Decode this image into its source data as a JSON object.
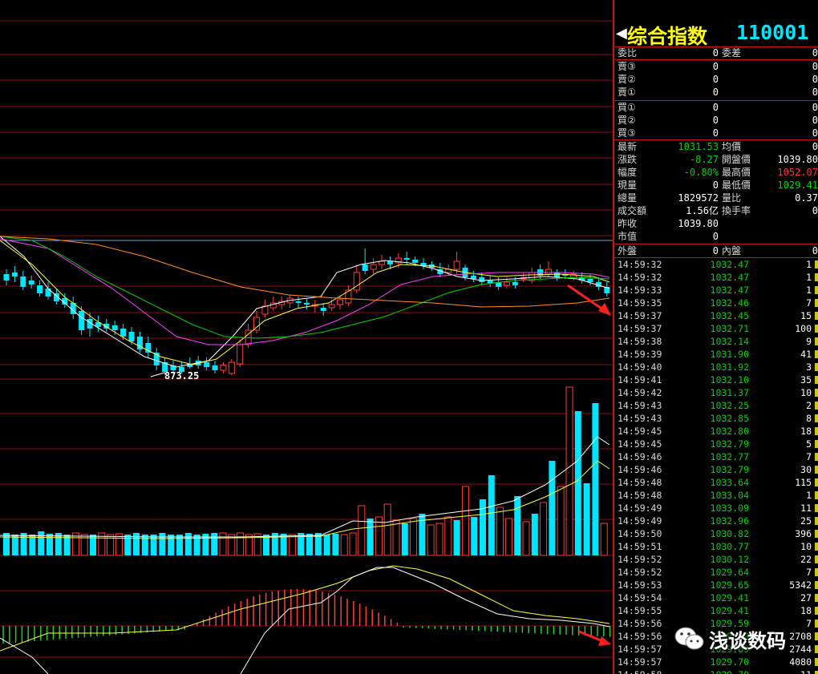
{
  "panel": {
    "title_name": "综合指数",
    "title_code": "110001",
    "order_ratio": {
      "label1": "委比",
      "value1": "0",
      "label2": "委差",
      "value2": "0"
    },
    "sell_levels": [
      {
        "label": "賣③",
        "value": "0"
      },
      {
        "label": "賣②",
        "value": "0"
      },
      {
        "label": "賣①",
        "value": "0"
      }
    ],
    "buy_levels": [
      {
        "label": "買①",
        "value": "0"
      },
      {
        "label": "買②",
        "value": "0"
      },
      {
        "label": "買③",
        "value": "0"
      }
    ],
    "stats": [
      {
        "l1": "最新",
        "v1": "1031.53",
        "c1": "#00d000",
        "l2": "均價",
        "v2": "0",
        "c2": "#ffffff"
      },
      {
        "l1": "漲跌",
        "v1": "-8.27",
        "c1": "#00d000",
        "l2": "開盤價",
        "v2": "1039.80",
        "c2": "#ffffff"
      },
      {
        "l1": "幅度",
        "v1": "-0.80%",
        "c1": "#00d000",
        "l2": "最高價",
        "v2": "1052.07",
        "c2": "#ff3030"
      },
      {
        "l1": "現量",
        "v1": "0",
        "c1": "#ffffff",
        "l2": "最低價",
        "v2": "1029.41",
        "c2": "#00d000"
      },
      {
        "l1": "總量",
        "v1": "1829572",
        "c1": "#ffffff",
        "l2": "量比",
        "v2": "0.37",
        "c2": "#ffffff"
      },
      {
        "l1": "成交額",
        "v1": "1.56亿",
        "c1": "#ffffff",
        "l2": "換手率",
        "v2": "0",
        "c2": "#ffffff"
      },
      {
        "l1": "昨收",
        "v1": "1039.80",
        "c1": "#ffffff",
        "l2": "",
        "v2": "",
        "c2": "#ffffff"
      },
      {
        "l1": "市值",
        "v1": "0",
        "c1": "#ffffff",
        "l2": "",
        "v2": "",
        "c2": "#ffffff"
      }
    ],
    "outer_inner": {
      "l1": "外盤",
      "v1": "0",
      "l2": "內盤",
      "v2": "0"
    },
    "trades": [
      {
        "time": "14:59:32",
        "price": "1032.47",
        "vol": "1"
      },
      {
        "time": "14:59:32",
        "price": "1032.47",
        "vol": "1"
      },
      {
        "time": "14:59:33",
        "price": "1032.47",
        "vol": "1"
      },
      {
        "time": "14:59:35",
        "price": "1032.46",
        "vol": "7"
      },
      {
        "time": "14:59:37",
        "price": "1032.45",
        "vol": "15"
      },
      {
        "time": "14:59:37",
        "price": "1032.71",
        "vol": "100"
      },
      {
        "time": "14:59:38",
        "price": "1032.14",
        "vol": "9"
      },
      {
        "time": "14:59:39",
        "price": "1031.90",
        "vol": "41"
      },
      {
        "time": "14:59:40",
        "price": "1031.92",
        "vol": "3"
      },
      {
        "time": "14:59:41",
        "price": "1032.10",
        "vol": "35"
      },
      {
        "time": "14:59:42",
        "price": "1031.37",
        "vol": "10"
      },
      {
        "time": "14:59:43",
        "price": "1032.25",
        "vol": "2"
      },
      {
        "time": "14:59:43",
        "price": "1032.85",
        "vol": "8"
      },
      {
        "time": "14:59:45",
        "price": "1032.80",
        "vol": "18"
      },
      {
        "time": "14:59:45",
        "price": "1032.79",
        "vol": "5"
      },
      {
        "time": "14:59:46",
        "price": "1032.77",
        "vol": "7"
      },
      {
        "time": "14:59:46",
        "price": "1032.79",
        "vol": "30"
      },
      {
        "time": "14:59:48",
        "price": "1033.64",
        "vol": "115"
      },
      {
        "time": "14:59:48",
        "price": "1033.04",
        "vol": "1"
      },
      {
        "time": "14:59:49",
        "price": "1033.09",
        "vol": "11"
      },
      {
        "time": "14:59:49",
        "price": "1032.96",
        "vol": "25"
      },
      {
        "time": "14:59:50",
        "price": "1030.82",
        "vol": "396"
      },
      {
        "time": "14:59:51",
        "price": "1030.77",
        "vol": "10"
      },
      {
        "time": "14:59:52",
        "price": "1030.12",
        "vol": "22"
      },
      {
        "time": "14:59:52",
        "price": "1029.64",
        "vol": "7"
      },
      {
        "time": "14:59:53",
        "price": "1029.65",
        "vol": "5342"
      },
      {
        "time": "14:59:54",
        "price": "1029.41",
        "vol": "27"
      },
      {
        "time": "14:59:55",
        "price": "1029.41",
        "vol": "18"
      },
      {
        "time": "14:59:56",
        "price": "1029.59",
        "vol": "7"
      },
      {
        "time": "14:59:56",
        "price": "1029.69",
        "vol": "2708"
      },
      {
        "time": "14:59:57",
        "price": "1029.69",
        "vol": "2744"
      },
      {
        "time": "14:59:57",
        "price": "1029.70",
        "vol": "4080"
      },
      {
        "time": "14:59:58",
        "price": "1029.70",
        "vol": "11"
      }
    ]
  },
  "chart": {
    "low_label": "873.25",
    "colors": {
      "up": "#ff3c3c",
      "down": "#00e5ff",
      "ma5": "#ffffff",
      "ma10": "#ffff40",
      "ma20": "#ff40ff",
      "ma30": "#00d000",
      "ma60": "#ff9020",
      "grid": "#8a1010"
    }
  },
  "watermark": {
    "text": "浅谈数码",
    "icon": "wechat-icon"
  }
}
